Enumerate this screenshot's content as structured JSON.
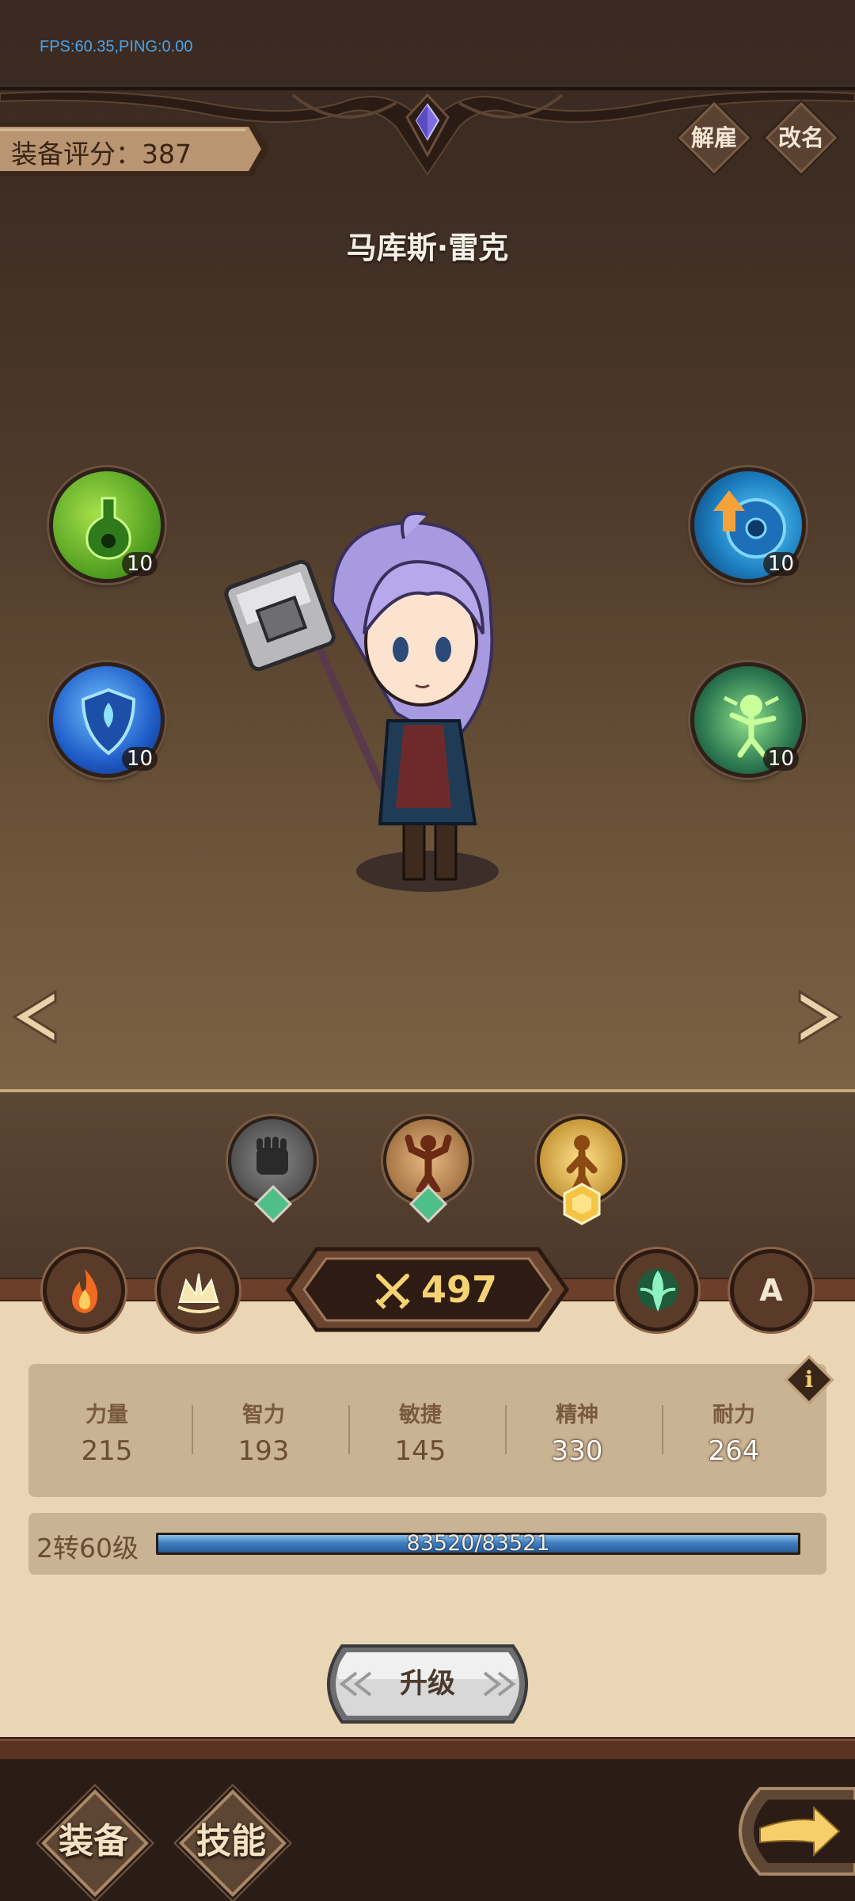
{
  "debug": {
    "fps_text": "FPS:60.35,PING:0.00"
  },
  "header": {
    "score_text": "装备评分：387",
    "dismiss_label": "解雇",
    "rename_label": "改名"
  },
  "hero": {
    "name": "马库斯·雷克"
  },
  "skills": [
    {
      "icon": "poison-potion-icon",
      "level": "10"
    },
    {
      "icon": "shield-ward-icon",
      "level": "10"
    },
    {
      "icon": "blue-disc-upgrade-icon",
      "level": "10"
    },
    {
      "icon": "goblin-summon-icon",
      "level": "10"
    }
  ],
  "traits": [
    {
      "icon": "iron-fist-icon",
      "gem": "green"
    },
    {
      "icon": "muscle-man-icon",
      "gem": "green"
    },
    {
      "icon": "golden-aura-man-icon",
      "gem": "gold"
    }
  ],
  "power": {
    "value": "497",
    "icon": "crossed-swords-icon"
  },
  "side_buttons": {
    "left": [
      "fire-icon",
      "crown-burst-icon"
    ],
    "right": [
      "spirit-icon",
      "A"
    ]
  },
  "stats": [
    {
      "name": "力量",
      "value": "215",
      "highlight": false
    },
    {
      "name": "智力",
      "value": "193",
      "highlight": false
    },
    {
      "name": "敏捷",
      "value": "145",
      "highlight": false
    },
    {
      "name": "精神",
      "value": "330",
      "highlight": true
    },
    {
      "name": "耐力",
      "value": "264",
      "highlight": true
    }
  ],
  "level": {
    "label": "2转60级",
    "xp_text": "83520/83521",
    "xp_fraction": 0.99999
  },
  "upgrade_label": "升级",
  "nav": {
    "equip_label": "装备",
    "skill_label": "技能"
  },
  "colors": {
    "power_gold": "#f6d372",
    "xp_blue": "#3f7fc0",
    "cream_panel": "#ead5b4"
  }
}
